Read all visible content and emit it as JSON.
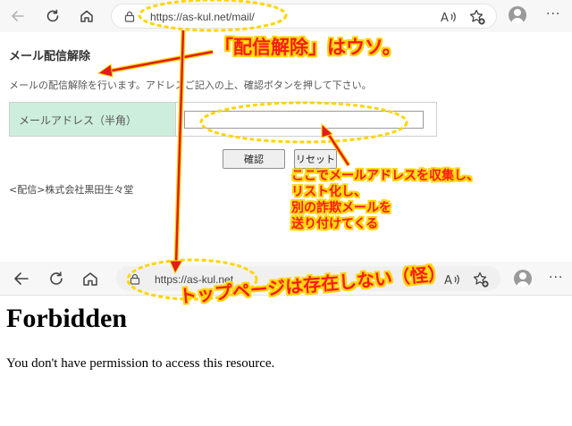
{
  "browser_top": {
    "url": "https://as-kul.net/mail/"
  },
  "mail_page": {
    "title": "メール配信解除",
    "description": "メールの配信解除を行います。アドレスご記入の上、確認ボタンを押して下さい。",
    "email_label": "メールアドレス（半角）",
    "email_value": "",
    "confirm_button": "確認",
    "reset_button": "リセット",
    "sender": "<配信>株式会社黒田生々堂"
  },
  "browser_bottom": {
    "url": "https://as-kul.net"
  },
  "forbidden_page": {
    "title": "Forbidden",
    "message": "You don't have permission to access this resource."
  },
  "annotations": {
    "fake_unsubscribe": "「配信解除」はウソ。",
    "harvest_note": "ここでメールアドレスを収集し、\nリスト化し、\n別の詐欺メールを\n送り付けてくる",
    "no_top_page": "トップページは存在しない（怪）",
    "color_text": "#ff1a1a",
    "color_outline": "#ffd500"
  },
  "icons": {
    "back": "back-arrow-icon",
    "refresh": "refresh-icon",
    "home": "home-icon",
    "lock": "lock-icon",
    "read_aloud": "read-aloud-icon",
    "favorite": "add-favorite-icon",
    "profile": "profile-avatar-icon",
    "more": "more-menu-icon"
  }
}
